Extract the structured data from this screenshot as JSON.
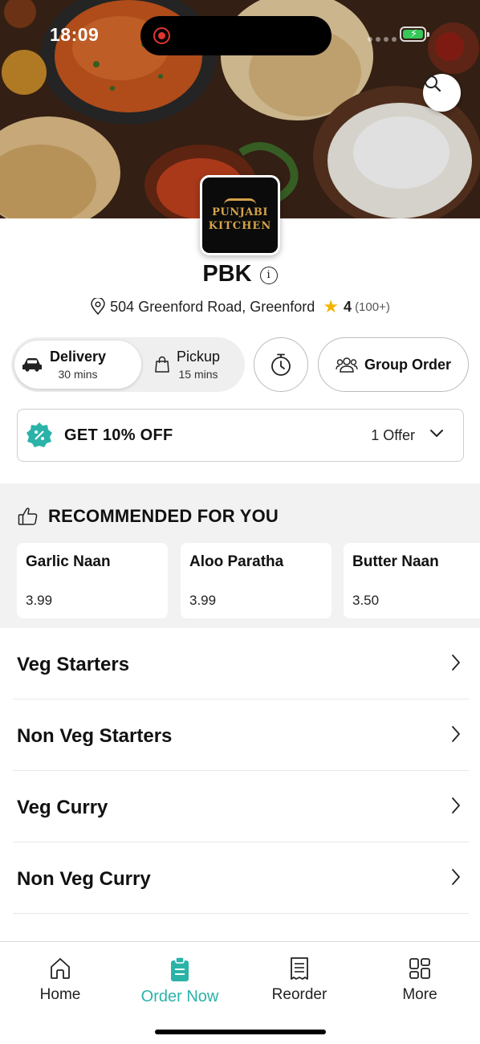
{
  "status_bar": {
    "time": "18:09"
  },
  "restaurant": {
    "logo_line1": "PUNJABI",
    "logo_line2": "KITCHEN",
    "name": "PBK",
    "address": "504 Greenford Road, Greenford",
    "rating": "4",
    "rating_count": "(100+)"
  },
  "order_mode": {
    "delivery": {
      "label": "Delivery",
      "time": "30 mins",
      "selected": true
    },
    "pickup": {
      "label": "Pickup",
      "time": "15 mins",
      "selected": false
    },
    "group_order_label": "Group Order"
  },
  "offer": {
    "title": "GET 10% OFF",
    "count": "1 Offer"
  },
  "recommended": {
    "heading": "RECOMMENDED FOR YOU",
    "items": [
      {
        "name": "Garlic Naan",
        "price": "3.99"
      },
      {
        "name": "Aloo Paratha",
        "price": "3.99"
      },
      {
        "name": "Butter Naan",
        "price": "3.50"
      }
    ]
  },
  "categories": [
    {
      "name": "Veg Starters"
    },
    {
      "name": "Non Veg Starters"
    },
    {
      "name": "Veg Curry"
    },
    {
      "name": "Non Veg Curry"
    }
  ],
  "bottom_nav": [
    {
      "label": "Home",
      "icon": "home-icon"
    },
    {
      "label": "Order Now",
      "icon": "order-icon",
      "active": true
    },
    {
      "label": "Reorder",
      "icon": "receipt-icon"
    },
    {
      "label": "More",
      "icon": "grid-icon"
    }
  ],
  "colors": {
    "accent": "#2bb3a8",
    "star": "#f5b400",
    "battery": "#35c759"
  }
}
